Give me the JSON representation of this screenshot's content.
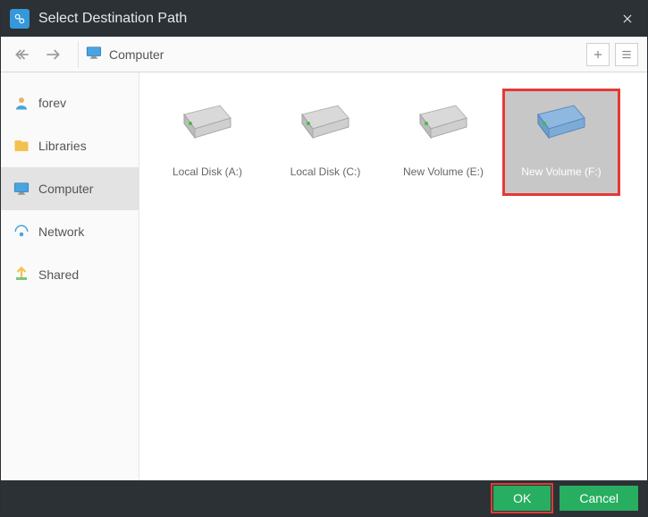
{
  "titlebar": {
    "title": "Select Destination Path"
  },
  "toolbar": {
    "breadcrumb": "Computer"
  },
  "sidebar": {
    "items": [
      {
        "label": "forev"
      },
      {
        "label": "Libraries"
      },
      {
        "label": "Computer"
      },
      {
        "label": "Network"
      },
      {
        "label": "Shared"
      }
    ],
    "selected_index": 2
  },
  "drives": [
    {
      "label": "Local Disk (A:)",
      "selected": false,
      "accent": "#6b6b6b"
    },
    {
      "label": "Local Disk (C:)",
      "selected": false,
      "accent": "#6b6b6b"
    },
    {
      "label": "New Volume (E:)",
      "selected": false,
      "accent": "#6b6b6b"
    },
    {
      "label": "New Volume (F:)",
      "selected": true,
      "accent": "#6aa0d8"
    }
  ],
  "footer": {
    "ok_label": "OK",
    "cancel_label": "Cancel"
  }
}
